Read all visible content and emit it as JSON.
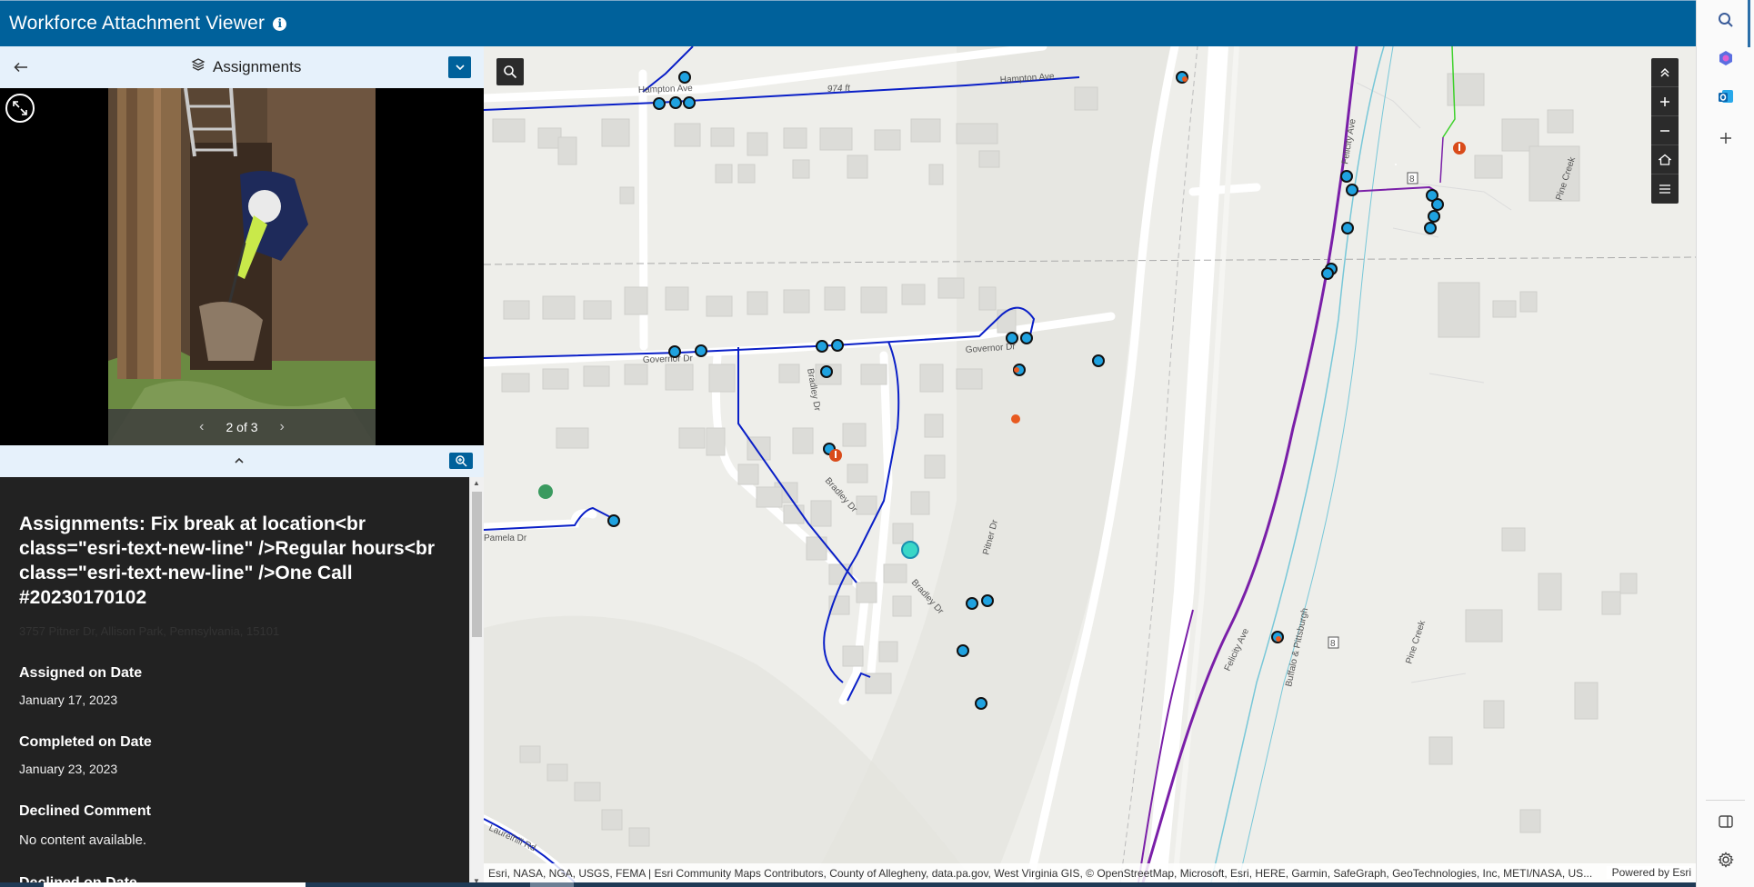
{
  "app": {
    "title": "Workforce Attachment Viewer",
    "accent": "#00619b"
  },
  "panel": {
    "title": "Assignments",
    "pager_text": "2 of 3"
  },
  "popup": {
    "heading": "Assignments: Fix break at location<br class=\"esri-text-new-line\" />Regular hours<br class=\"esri-text-new-line\" />One Call #20230170102",
    "address": "3757 Pitner Dr, Allison Park, Pennsylvania, 15101",
    "fields": [
      {
        "label": "Assigned on Date",
        "value": "January 17, 2023"
      },
      {
        "label": "Completed on Date",
        "value": "January 23, 2023"
      },
      {
        "label": "Declined Comment",
        "value": "No content available."
      },
      {
        "label": "Declined on Date",
        "value": ""
      }
    ]
  },
  "map": {
    "attribution": "Esri, NASA, NGA, USGS, FEMA | Esri Community Maps Contributors, County of Allegheny, data.pa.gov, West Virginia GIS, © OpenStreetMap, Microsoft, Esri, HERE, Garmin, SafeGraph, GeoTechnologies, Inc, METI/NASA, US...",
    "powered_by": "Powered by Esri",
    "labels": {
      "hampton_ave_1": "Hampton Ave",
      "hampton_ave_2": "Hampton Ave",
      "distance": "974 ft",
      "governor_dr_1": "Governor Dr",
      "governor_dr_2": "Governor Dr",
      "bradley_dr_1": "Bradley Dr",
      "bradley_dr_2": "Bradley Dr",
      "bradley_dr_3": "Bradley Dr",
      "pitner_dr": "Pitner Dr",
      "pamela_dr": "Pamela Dr",
      "laurelhill_rd": "Laurelhill Rd",
      "felicity_ave_1": "Felicity Ave",
      "felicity_ave_2": "Felicity Ave",
      "buffalo_pittsburgh": "Buffalo & Pittsburgh",
      "pine_creek_1": "Pine Creek",
      "pine_creek_2": "Pine Creek",
      "route_8_a": "8",
      "route_8_b": "8"
    },
    "colors": {
      "water_main": "#0a1fc7",
      "highway": "#7a1fa8",
      "lateral": "#3ed12b",
      "stream": "#77c7d8",
      "valve": "#1fa2e0"
    }
  },
  "icons": {
    "info": "info-icon",
    "back": "arrow-left-icon",
    "layers": "layers-icon",
    "dropdown": "chevron-down-icon",
    "expand": "expand-icon",
    "zoom": "zoom-in-icon",
    "search": "search-icon",
    "copilot": "copilot-icon",
    "outlook": "outlook-icon",
    "add": "plus-icon",
    "sidebar": "sidebar-toggle-icon",
    "settings": "gear-icon"
  }
}
